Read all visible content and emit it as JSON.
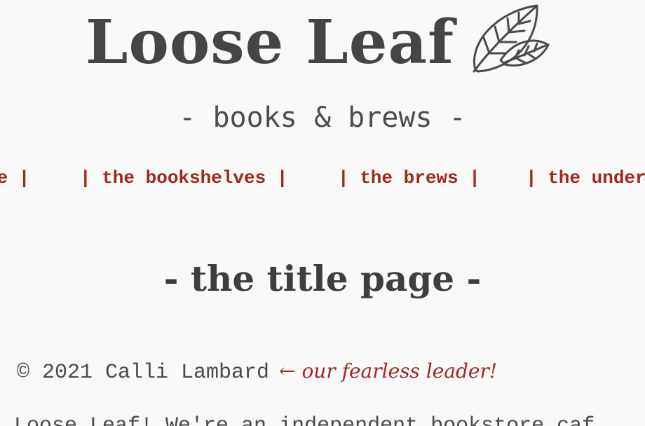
{
  "header": {
    "title": "Loose Leaf",
    "tagline": "- books & brews -",
    "logo_icon": "leaf-icon"
  },
  "nav": {
    "items": [
      {
        "label": "ge |"
      },
      {
        "label": "| the bookshelves |"
      },
      {
        "label": "| the brews |"
      },
      {
        "label": "| the under"
      }
    ]
  },
  "main": {
    "heading": "- the title page -",
    "credit_text": ". © 2021 Calli Lambard",
    "credit_note": "← our fearless leader!",
    "intro_text": "e Loose Leaf! We're an independent bookstore caf"
  },
  "colors": {
    "accent": "#a0281c",
    "text": "#4a4a4a",
    "background": "#f9f9f9"
  }
}
